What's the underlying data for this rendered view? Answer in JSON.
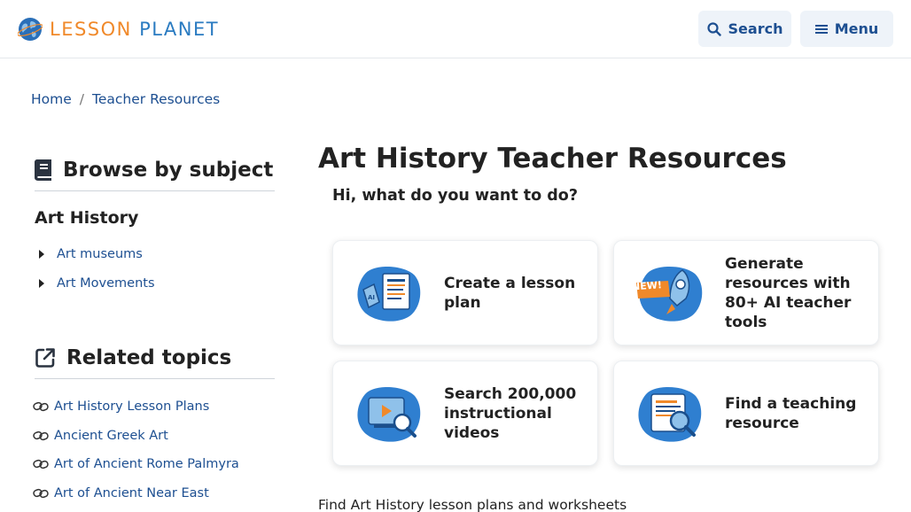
{
  "header": {
    "logo_word1": "LESSON",
    "logo_word2": "PLANET",
    "search_label": "Search",
    "menu_label": "Menu"
  },
  "breadcrumb": {
    "home": "Home",
    "separator": "/",
    "current": "Teacher Resources"
  },
  "sidebar": {
    "browse_heading": "Browse by subject",
    "subject": "Art History",
    "subjects": [
      "Art museums",
      "Art Movements"
    ],
    "related_heading": "Related topics",
    "related": [
      "Art History Lesson Plans",
      "Ancient Greek Art",
      "Art of Ancient Rome Palmyra",
      "Art of Ancient Near East"
    ]
  },
  "main": {
    "title": "Art History Teacher Resources",
    "prompt": "Hi, what do you want to do?",
    "cards": [
      {
        "label": "Create a lesson plan",
        "icon": "lesson-plan-icon"
      },
      {
        "label": "Generate resources with 80+ AI teacher tools",
        "icon": "ai-rocket-icon",
        "badge": "NEW!"
      },
      {
        "label": "Search 200,000 instructional videos",
        "icon": "video-search-icon"
      },
      {
        "label": "Find a teaching resource",
        "icon": "document-search-icon"
      }
    ],
    "footer_text": "Find Art History lesson plans and worksheets"
  },
  "colors": {
    "link": "#1d4f91",
    "logo_orange": "#f0892a",
    "logo_blue": "#2a7bc1",
    "button_bg": "#eef3f9",
    "illustration_blue": "#2f7fd0"
  }
}
